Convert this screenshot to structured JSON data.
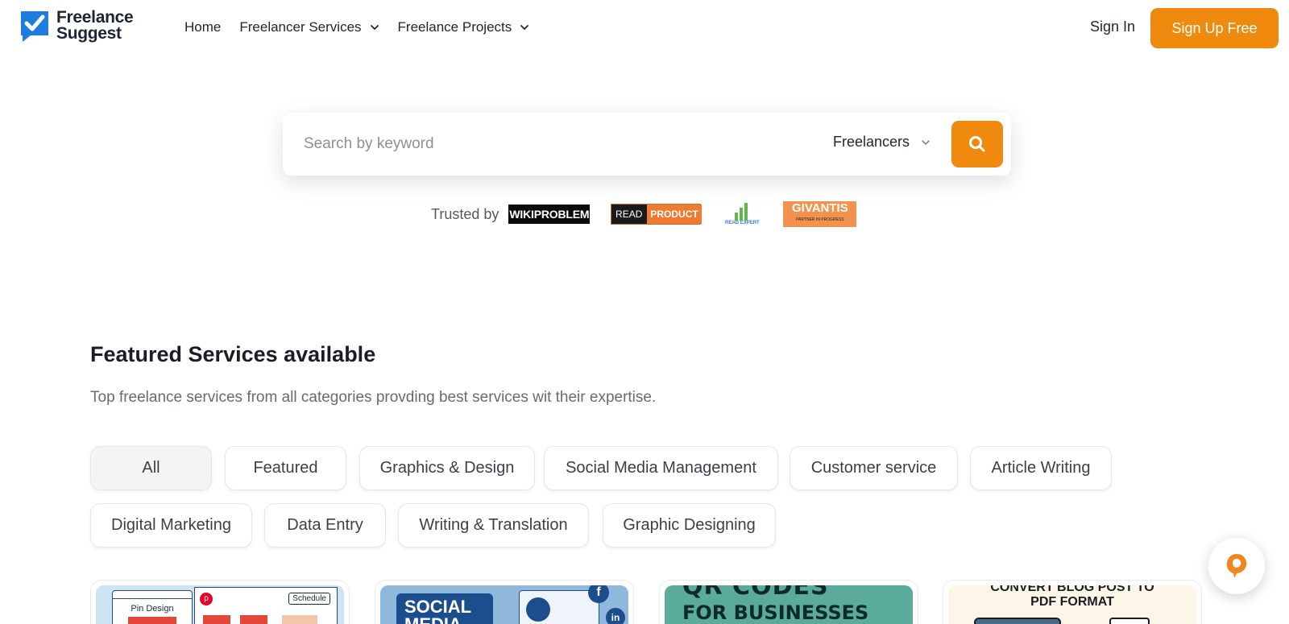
{
  "header": {
    "logo_line1": "Freelance",
    "logo_line2": "Suggest",
    "nav": [
      {
        "label": "Home"
      },
      {
        "label": "Freelancer Services"
      },
      {
        "label": "Freelance Projects"
      }
    ],
    "sign_in": "Sign In",
    "sign_up": "Sign Up Free"
  },
  "search": {
    "placeholder": "Search by keyword",
    "type": "Freelancers"
  },
  "trusted": {
    "label": "Trusted by",
    "brands": [
      "WIKIPROBLEM",
      "READ",
      "PRODUCT",
      "READ EXPERT",
      "GIVANTIS",
      "PARTNER IN PROGRESS"
    ]
  },
  "featured": {
    "title": "Featured Services available",
    "subtitle": "Top freelance services from all categories provding best services wit their expertise.",
    "chips": [
      {
        "label": "All"
      },
      {
        "label": "Featured"
      },
      {
        "label": "Graphics & Design"
      },
      {
        "label": "Social Media Management"
      },
      {
        "label": "Customer service"
      },
      {
        "label": "Article Writing"
      },
      {
        "label": "Digital Marketing"
      },
      {
        "label": "Data Entry"
      },
      {
        "label": "Writing & Translation"
      },
      {
        "label": "Graphic Designing"
      }
    ]
  },
  "cards": [
    {
      "text1": "Pin Design",
      "text2": "Schedule"
    },
    {
      "text1": "SOCIAL",
      "text2": "MEDIA"
    },
    {
      "text1": "QR CODES",
      "text2": "FOR BUSINESSES"
    },
    {
      "text1": "CONVERT BLOG POST TO",
      "text2": "PDF FORMAT"
    }
  ],
  "colors": {
    "accent": "#f08a0e",
    "logo_blue": "#1e7be0"
  }
}
